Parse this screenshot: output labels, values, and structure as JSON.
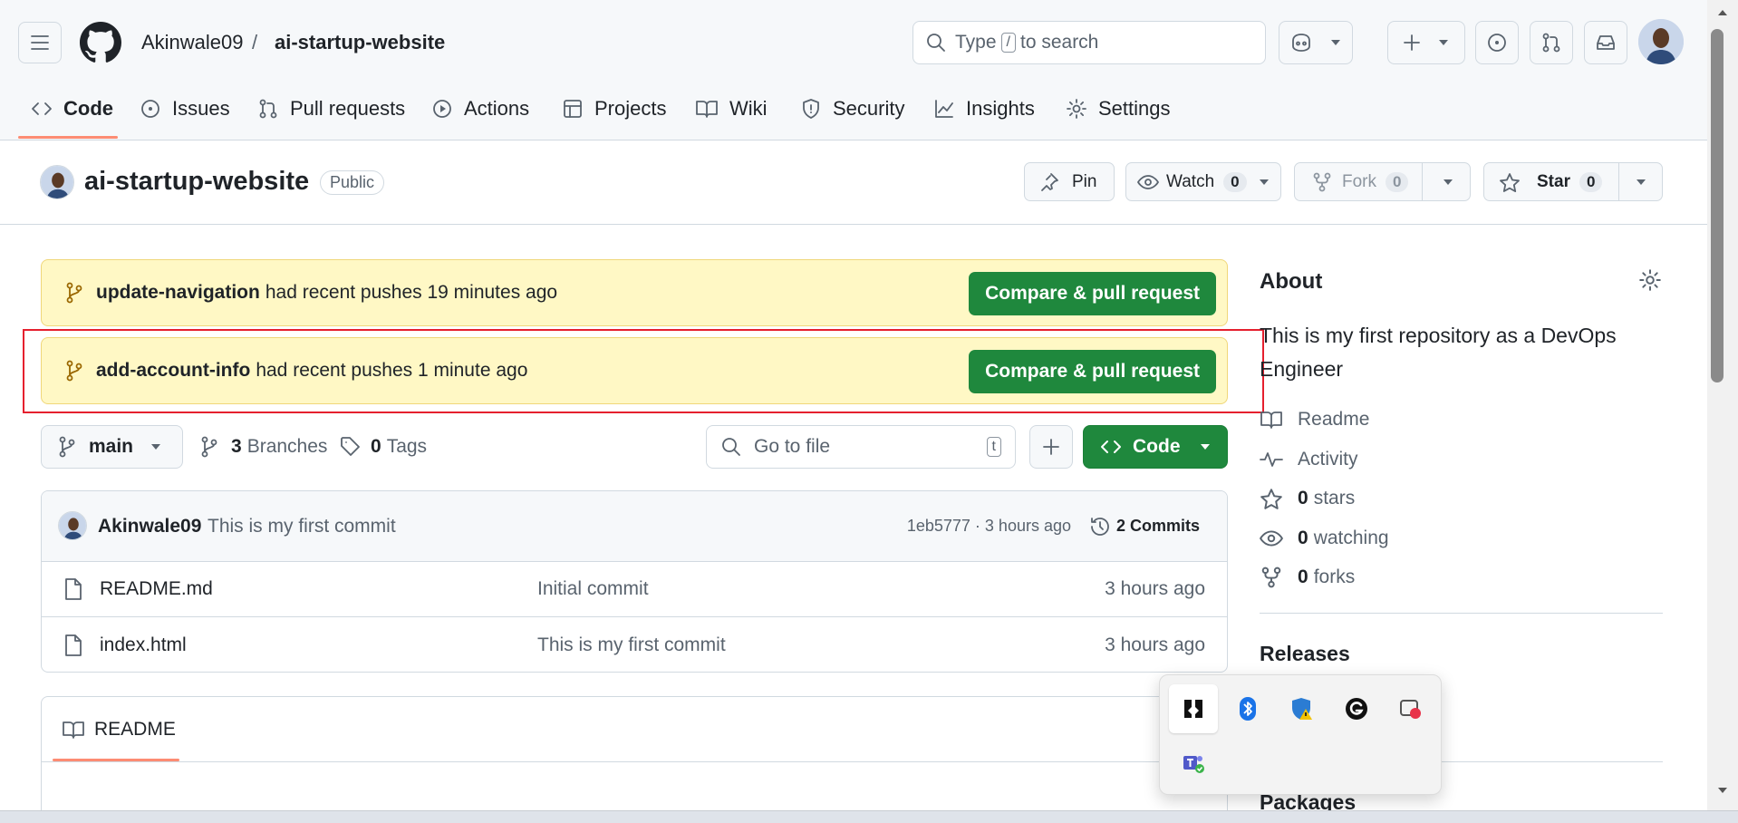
{
  "header": {
    "owner": "Akinwale09",
    "separator": "/",
    "repo": "ai-startup-website",
    "search_prefix": "Type",
    "search_key": "/",
    "search_suffix": "to search"
  },
  "tabs": [
    {
      "label": "Code"
    },
    {
      "label": "Issues"
    },
    {
      "label": "Pull requests"
    },
    {
      "label": "Actions"
    },
    {
      "label": "Projects"
    },
    {
      "label": "Wiki"
    },
    {
      "label": "Security"
    },
    {
      "label": "Insights"
    },
    {
      "label": "Settings"
    }
  ],
  "repo_header": {
    "name": "ai-startup-website",
    "visibility": "Public",
    "pin": "Pin",
    "watch": "Watch",
    "watch_count": "0",
    "fork": "Fork",
    "fork_count": "0",
    "star": "Star",
    "star_count": "0"
  },
  "banners": [
    {
      "branch": "update-navigation",
      "text": "had recent pushes 19 minutes ago",
      "button": "Compare & pull request"
    },
    {
      "branch": "add-account-info",
      "text": "had recent pushes 1 minute ago",
      "button": "Compare & pull request"
    }
  ],
  "toolbar": {
    "branch": "main",
    "branches_count": "3",
    "branches_label": "Branches",
    "tags_count": "0",
    "tags_label": "Tags",
    "goto_placeholder": "Go to file",
    "goto_key": "t",
    "code_button": "Code"
  },
  "commit": {
    "author": "Akinwale09",
    "message": "This is my first commit",
    "meta": "1eb5777 · 3 hours ago",
    "commits": "2 Commits"
  },
  "files": [
    {
      "name": "README.md",
      "message": "Initial commit",
      "time": "3 hours ago"
    },
    {
      "name": "index.html",
      "message": "This is my first commit",
      "time": "3 hours ago"
    }
  ],
  "readme_tab": "README",
  "about": {
    "title": "About",
    "description": "This is my first repository as a DevOps Engineer",
    "readme": "Readme",
    "activity": "Activity",
    "stars_count": "0",
    "stars_label": "stars",
    "watching_count": "0",
    "watching_label": "watching",
    "forks_count": "0",
    "forks_label": "forks",
    "releases": "Releases",
    "packages": "Packages"
  },
  "colors": {
    "accent_green": "#1f883d",
    "banner_bg": "#fff8c5",
    "highlight_red": "#e5202e",
    "tab_underline": "#fd8c73"
  }
}
